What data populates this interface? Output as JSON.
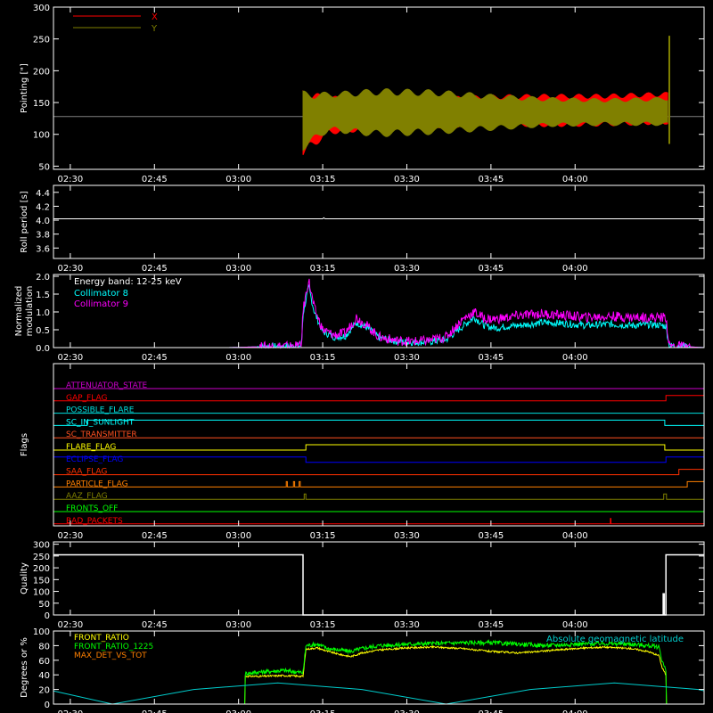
{
  "chart_data": [
    {
      "type": "line",
      "ylabel": "Pointing [\"]",
      "ylim": [
        45,
        300
      ],
      "yticks": [
        50,
        100,
        150,
        200,
        250,
        300
      ],
      "x_ticks": [
        "02:30",
        "02:45",
        "03:00",
        "03:15",
        "03:30",
        "03:45",
        "04:00"
      ],
      "legend": [
        {
          "name": "X",
          "color": "#ff0000"
        },
        {
          "name": "Y",
          "color": "#808000"
        }
      ],
      "series": [
        {
          "name": "X",
          "color": "#ff0000",
          "band_time": [
            41.5,
            46,
            55,
            65,
            75,
            85,
            95,
            105,
            106.5
          ],
          "band_max": [
            170,
            160,
            158,
            158,
            162,
            163,
            163,
            166,
            166
          ],
          "band_min": [
            65,
            100,
            107,
            110,
            113,
            112,
            113,
            116,
            116
          ]
        },
        {
          "name": "Y",
          "color": "#808000",
          "band_time": [
            41.5,
            46,
            55,
            65,
            75,
            85,
            95,
            105,
            106.5
          ],
          "band_max": [
            168,
            166,
            172,
            170,
            163,
            158,
            156,
            158,
            160
          ],
          "band_min": [
            75,
            104,
            96,
            100,
            106,
            112,
            114,
            114,
            112
          ]
        }
      ],
      "baseline": {
        "value": 128,
        "color": "#808080"
      },
      "spike": {
        "time": 106.8,
        "min": 85,
        "max": 255
      }
    },
    {
      "type": "line",
      "ylabel": "Roll period [s]",
      "ylim": [
        3.45,
        4.5
      ],
      "yticks": [
        3.6,
        3.8,
        4.0,
        4.2,
        4.4
      ],
      "yticklabels": [
        "3.6",
        "3.8",
        "4.0",
        "4.2",
        "4.4"
      ],
      "x_ticks": [
        "02:30",
        "02:45",
        "03:00",
        "03:15",
        "03:30",
        "03:45",
        "04:00"
      ],
      "series": [
        {
          "name": "Roll period",
          "color": "#ffffff",
          "time": [
            -3,
            45,
            45.2,
            45.4,
            113
          ],
          "values": [
            4.02,
            4.02,
            4.035,
            4.02,
            4.02
          ]
        }
      ]
    },
    {
      "type": "line",
      "ylabel": "Normalized modulation",
      "ylim": [
        0,
        2.05
      ],
      "yticks": [
        0,
        0.5,
        1.0,
        1.5,
        2.0
      ],
      "yticklabels": [
        "0.0",
        "0.5",
        "1.0",
        "1.5",
        "2.0"
      ],
      "x_ticks": [
        "02:30",
        "02:45",
        "03:00",
        "03:15",
        "03:30",
        "03:45",
        "04:00"
      ],
      "annotations": [
        "Energy band: 12-25 keV"
      ],
      "series": [
        {
          "name": "Collimator 8",
          "color": "#00ffff",
          "time": [
            -3,
            28,
            41.2,
            41.5,
            42.5,
            43.5,
            45,
            47,
            49,
            51,
            53,
            55,
            58,
            61,
            64,
            67,
            70,
            72,
            74,
            76,
            78,
            80,
            84,
            88,
            92,
            96,
            100,
            104,
            106.2,
            106.8,
            113
          ],
          "values": [
            0,
            0,
            0.05,
            0.95,
            1.7,
            1.0,
            0.45,
            0.3,
            0.32,
            0.7,
            0.55,
            0.28,
            0.18,
            0.15,
            0.16,
            0.22,
            0.6,
            0.85,
            0.6,
            0.55,
            0.6,
            0.62,
            0.7,
            0.68,
            0.62,
            0.66,
            0.62,
            0.65,
            0.6,
            0.05,
            0
          ]
        },
        {
          "name": "Collimator 9",
          "color": "#ff00ff",
          "time": [
            -3,
            28,
            41.2,
            41.5,
            42.5,
            43.5,
            45,
            47,
            49,
            51,
            53,
            55,
            58,
            61,
            64,
            67,
            70,
            72,
            74,
            76,
            78,
            80,
            84,
            88,
            92,
            96,
            100,
            104,
            106.2,
            106.8,
            113
          ],
          "values": [
            0,
            0,
            0.05,
            1.05,
            1.9,
            1.1,
            0.5,
            0.35,
            0.4,
            0.85,
            0.6,
            0.3,
            0.2,
            0.17,
            0.2,
            0.3,
            0.8,
            1.0,
            0.8,
            0.8,
            0.85,
            0.9,
            0.95,
            0.9,
            0.85,
            0.88,
            0.85,
            0.85,
            0.85,
            0.05,
            0
          ]
        }
      ]
    },
    {
      "type": "line",
      "ylabel": "Flags",
      "x_ticks": [
        "02:30",
        "02:45",
        "03:00",
        "03:15",
        "03:30",
        "03:45",
        "04:00"
      ],
      "flags": [
        {
          "name": "ATTENUATOR_STATE",
          "color": "#cc00cc",
          "segments": [
            [
              -3,
              0
            ],
            [
              113,
              0
            ]
          ]
        },
        {
          "name": "GAP_FLAG",
          "color": "#ff0000",
          "segments": [
            [
              -3,
              0
            ],
            [
              106.2,
              0
            ],
            [
              106.2,
              1
            ],
            [
              113,
              1
            ]
          ]
        },
        {
          "name": "POSSIBLE_FLARE",
          "color": "#00e0e0",
          "segments": [
            [
              -3,
              0
            ],
            [
              113,
              0
            ]
          ]
        },
        {
          "name": "SC_IN_SUNLIGHT",
          "color": "#00ffff",
          "segments": [
            [
              -3,
              0
            ],
            [
              3,
              0
            ],
            [
              3,
              1
            ],
            [
              42,
              1
            ],
            [
              42,
              1
            ],
            [
              106,
              1
            ],
            [
              106,
              0
            ],
            [
              113,
              0
            ]
          ]
        },
        {
          "name": "SC_TRANSMITTER",
          "color": "#ff5020",
          "segments": [
            [
              -3,
              0
            ],
            [
              113,
              0
            ]
          ]
        },
        {
          "name": "FLARE_FLAG",
          "color": "#ffff00",
          "segments": [
            [
              -3,
              0
            ],
            [
              42,
              0
            ],
            [
              42,
              1
            ],
            [
              106,
              1
            ],
            [
              106,
              0
            ],
            [
              113,
              0
            ]
          ]
        },
        {
          "name": "ECLIPSE_FLAG",
          "color": "#0000ff",
          "segments": [
            [
              -3,
              1
            ],
            [
              42,
              1
            ],
            [
              42,
              0
            ],
            [
              106.2,
              0
            ],
            [
              106.2,
              1
            ],
            [
              113,
              1
            ]
          ]
        },
        {
          "name": "SAA_FLAG",
          "color": "#ff3000",
          "segments": [
            [
              -3,
              0
            ],
            [
              108.5,
              0
            ],
            [
              108.5,
              1
            ],
            [
              113,
              1
            ]
          ]
        },
        {
          "name": "PARTICLE_FLAG",
          "color": "#ff8000",
          "segments": [
            [
              -3,
              0
            ],
            [
              38.5,
              0
            ],
            [
              38.5,
              1
            ],
            [
              38.7,
              1
            ],
            [
              38.7,
              0
            ],
            [
              39.8,
              0
            ],
            [
              39.8,
              1
            ],
            [
              40.0,
              1
            ],
            [
              40.0,
              0
            ],
            [
              40.8,
              0
            ],
            [
              40.8,
              1
            ],
            [
              41.0,
              1
            ],
            [
              41.0,
              0
            ],
            [
              110,
              0
            ],
            [
              110,
              1
            ],
            [
              113,
              1
            ]
          ]
        },
        {
          "name": "AAZ_FLAG",
          "color": "#808000",
          "segments": [
            [
              -3,
              0
            ],
            [
              41.7,
              0
            ],
            [
              41.7,
              1
            ],
            [
              42.0,
              1
            ],
            [
              42.0,
              0
            ],
            [
              105.8,
              0
            ],
            [
              105.8,
              1
            ],
            [
              106.3,
              1
            ],
            [
              106.3,
              0
            ],
            [
              113,
              0
            ]
          ]
        },
        {
          "name": "FRONTS_OFF",
          "color": "#00ff00",
          "segments": [
            [
              -3,
              0
            ],
            [
              113,
              0
            ]
          ]
        },
        {
          "name": "BAD_PACKETS",
          "color": "#ff0000",
          "segments": [
            [
              -3,
              0
            ],
            [
              96.3,
              0
            ],
            [
              96.3,
              1
            ],
            [
              96.4,
              1
            ],
            [
              96.4,
              0
            ],
            [
              113,
              0
            ]
          ]
        }
      ]
    },
    {
      "type": "line",
      "ylabel": "Quality",
      "ylim": [
        0,
        310
      ],
      "yticks": [
        0,
        50,
        100,
        150,
        200,
        250,
        300
      ],
      "x_ticks": [
        "02:30",
        "02:45",
        "03:00",
        "03:15",
        "03:30",
        "03:45",
        "04:00"
      ],
      "series": [
        {
          "name": "Quality",
          "color": "#ffffff",
          "time": [
            -3,
            41.5,
            41.5,
            105.7,
            105.7,
            105.9,
            105.9,
            106.2,
            106.2,
            113
          ],
          "values": [
            255,
            255,
            0,
            0,
            90,
            90,
            0,
            0,
            255,
            255
          ]
        }
      ]
    },
    {
      "type": "line",
      "ylabel": "Degrees or %",
      "ylim": [
        0,
        100
      ],
      "yticks": [
        0,
        20,
        40,
        60,
        80,
        100
      ],
      "x_ticks": [
        "02:30",
        "02:45",
        "03:00",
        "03:15",
        "03:30",
        "03:45",
        "04:00"
      ],
      "legend": [
        {
          "name": "FRONT_RATIO",
          "color": "#ffff00"
        },
        {
          "name": "FRONT_RATIO_1225",
          "color": "#00ff00"
        },
        {
          "name": "MAX_DET_VS_TOT",
          "color": "#ff8000"
        }
      ],
      "annotations": [
        "Absolute geomagnetic latitude"
      ],
      "series": [
        {
          "name": "FRONT_RATIO",
          "color": "#ffff00",
          "time": [
            -3,
            31.2,
            31.2,
            34,
            38,
            41.5,
            42,
            44,
            46,
            48,
            50,
            52,
            55,
            60,
            65,
            70,
            75,
            80,
            85,
            90,
            95,
            100,
            103,
            105,
            105.5,
            106.2,
            106.2,
            113
          ],
          "values": [
            0,
            0,
            38,
            38,
            39,
            38,
            75,
            77,
            72,
            68,
            65,
            70,
            74,
            77,
            78,
            76,
            72,
            70,
            73,
            76,
            78,
            76,
            72,
            66,
            50,
            40,
            0,
            0
          ]
        },
        {
          "name": "FRONT_RATIO_1225",
          "color": "#00ff00",
          "time": [
            -3,
            31.2,
            31.2,
            34,
            38,
            41.5,
            42,
            44,
            46,
            48,
            50,
            52,
            55,
            60,
            65,
            70,
            75,
            80,
            85,
            90,
            95,
            100,
            103,
            105,
            105.5,
            106.2,
            106.2,
            113
          ],
          "values": [
            0,
            0,
            42,
            44,
            46,
            43,
            80,
            82,
            76,
            74,
            72,
            76,
            80,
            82,
            83,
            84,
            84,
            82,
            80,
            82,
            83,
            82,
            80,
            78,
            60,
            45,
            0,
            0
          ]
        },
        {
          "name": "MAX_DET_VS_TOT",
          "color": "#ff8000",
          "time": [
            -3,
            113
          ],
          "values": [
            0,
            0
          ]
        },
        {
          "name": "Absolute geomagnetic latitude",
          "color": "#00cccc",
          "time": [
            -3,
            7.5,
            22,
            37,
            52,
            67,
            82,
            97,
            112,
            113
          ],
          "values": [
            18,
            0,
            20,
            29,
            20,
            0,
            20,
            29,
            20,
            18
          ]
        }
      ]
    }
  ]
}
